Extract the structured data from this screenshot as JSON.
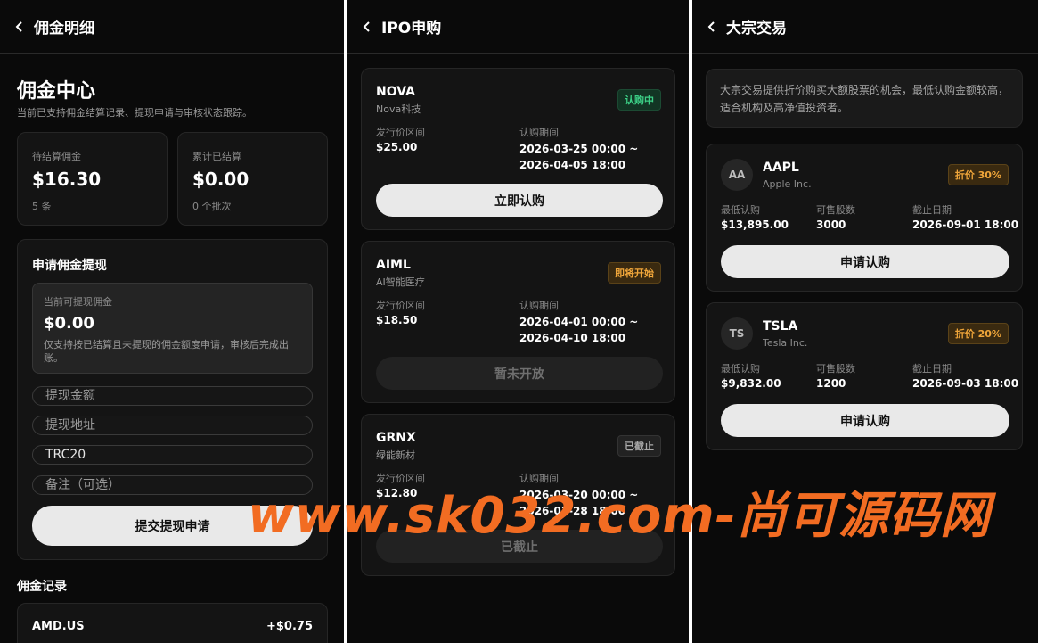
{
  "commission": {
    "header_title": "佣金明细",
    "title": "佣金中心",
    "description": "当前已支持佣金结算记录、提现申请与审核状态跟踪。",
    "pending": {
      "label": "待结算佣金",
      "amount": "$16.30",
      "sub": "5 条"
    },
    "settled": {
      "label": "累计已结算",
      "amount": "$0.00",
      "sub": "0 个批次"
    },
    "withdraw": {
      "title": "申请佣金提现",
      "available_label": "当前可提现佣金",
      "available_amount": "$0.00",
      "available_note": "仅支持按已结算且未提现的佣金额度申请，审核后完成出账。",
      "amount_placeholder": "提现金额",
      "address_placeholder": "提现地址",
      "network_value": "TRC20",
      "remark_placeholder": "备注（可选）",
      "submit_label": "提交提现申请"
    },
    "records_title": "佣金记录",
    "records": [
      {
        "symbol": "AMD.US",
        "amount": "+$0.75"
      }
    ]
  },
  "ipo": {
    "header_title": "IPO申购",
    "price_label": "发行价区间",
    "period_label": "认购期间",
    "items": [
      {
        "symbol": "NOVA",
        "name": "Nova科技",
        "status": "认购中",
        "price": "$25.00",
        "period": "2026-03-25 00:00 ~ 2026-04-05 18:00",
        "button": "立即认购"
      },
      {
        "symbol": "AIML",
        "name": "AI智能医疗",
        "status": "即将开始",
        "price": "$18.50",
        "period": "2026-04-01 00:00 ~ 2026-04-10 18:00",
        "button": "暂未开放"
      },
      {
        "symbol": "GRNX",
        "name": "绿能新材",
        "status": "已截止",
        "price": "$12.80",
        "period": "2026-03-20 00:00 ~ 2026-03-28 18:00",
        "button": "已截止"
      }
    ]
  },
  "block": {
    "header_title": "大宗交易",
    "intro": "大宗交易提供折价购买大额股票的机会，最低认购金额较高，适合机构及高净值投资者。",
    "min_label": "最低认购",
    "shares_label": "可售股数",
    "deadline_label": "截止日期",
    "items": [
      {
        "avatar": "AA",
        "symbol": "AAPL",
        "name": "Apple Inc.",
        "discount": "折价 30%",
        "min": "$13,895.00",
        "shares": "3000",
        "deadline": "2026-09-01 18:00",
        "button": "申请认购"
      },
      {
        "avatar": "TS",
        "symbol": "TSLA",
        "name": "Tesla Inc.",
        "discount": "折价 20%",
        "min": "$9,832.00",
        "shares": "1200",
        "deadline": "2026-09-03 18:00",
        "button": "申请认购"
      }
    ]
  },
  "watermark": "www.sk032.com-尚可源码网",
  "colors": {
    "background": "#0a0a0a",
    "card": "#141414",
    "accent_green": "#3ccf86",
    "accent_orange": "#f0a63a",
    "watermark": "#f26c22"
  }
}
